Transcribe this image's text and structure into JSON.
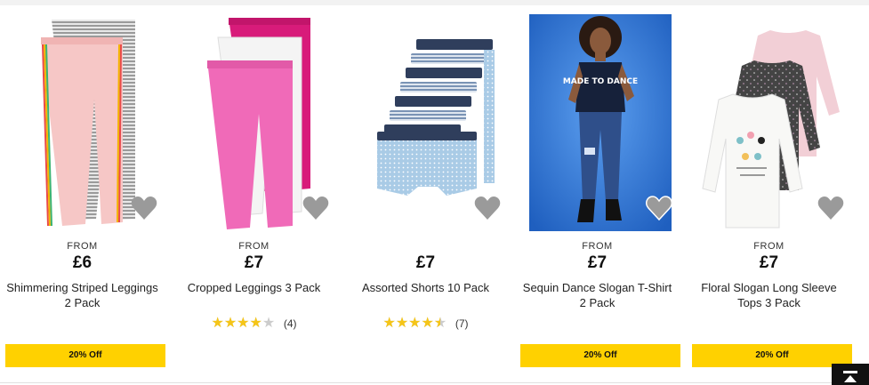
{
  "products": [
    {
      "from_label": "FROM",
      "price": "£6",
      "name": "Shimmering Striped Leggings 2 Pack",
      "rating": null,
      "review_count": null,
      "promo": "20% Off",
      "image_icon": "leggings-image"
    },
    {
      "from_label": "FROM",
      "price": "£7",
      "name": "Cropped Leggings 3 Pack",
      "rating": 4,
      "review_count": "(4)",
      "promo": null,
      "image_icon": "cropped-leggings-image"
    },
    {
      "from_label": "",
      "price": "£7",
      "name": "Assorted Shorts 10 Pack",
      "rating": 4.5,
      "review_count": "(7)",
      "promo": null,
      "image_icon": "shorts-image"
    },
    {
      "from_label": "FROM",
      "price": "£7",
      "name": "Sequin Dance Slogan T-Shirt 2 Pack",
      "rating": null,
      "review_count": null,
      "promo": "20% Off",
      "image_icon": "model-photo"
    },
    {
      "from_label": "FROM",
      "price": "£7",
      "name": "Floral Slogan Long Sleeve Tops 3 Pack",
      "rating": null,
      "review_count": null,
      "promo": "20% Off",
      "image_icon": "long-sleeve-tops-image"
    }
  ],
  "tshirt_slogan": "MADE TO DANCE",
  "stars_glyphs": "★★★★★",
  "icons": {
    "wishlist": "heart-icon",
    "back_to_top": "arrow-up-icon"
  },
  "colors": {
    "promo_bg": "#ffd100",
    "star": "#f5c518",
    "heart": "#9a9a9a"
  }
}
